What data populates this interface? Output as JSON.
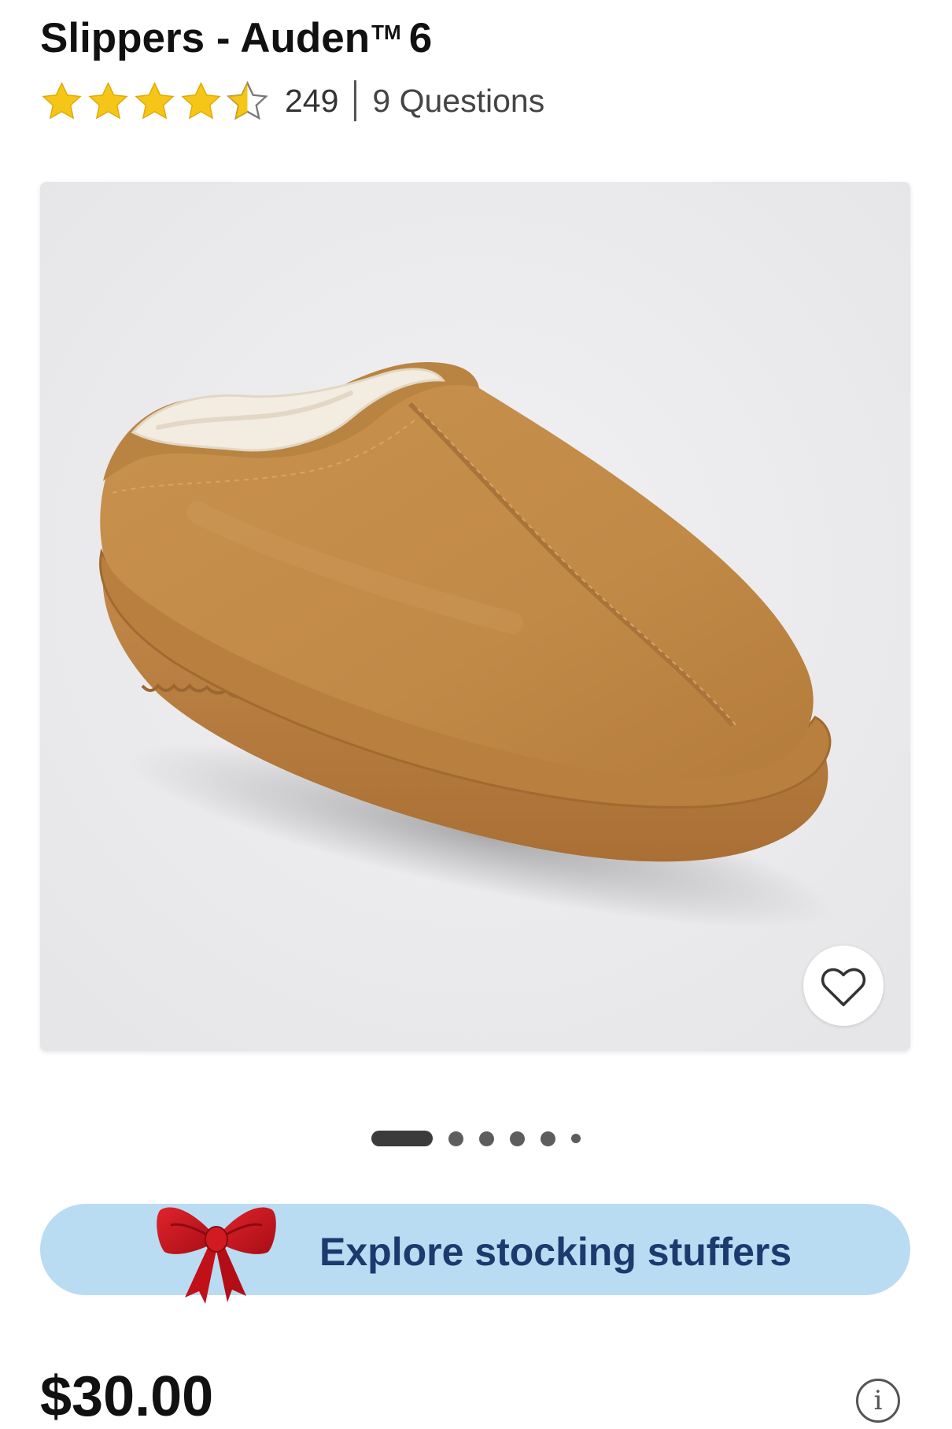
{
  "product": {
    "title_line2": "Slippers - Auden",
    "title_trademark": "TM",
    "title_line2_suffix": "6"
  },
  "rating": {
    "value": 4.5,
    "max": 5,
    "reviews_count": "249",
    "questions_label": "9 Questions"
  },
  "gallery": {
    "image_subject": "tan suede slip-on slipper with cream sherpa lining",
    "carousel_total": 6,
    "carousel_active_index": 0
  },
  "promo": {
    "label": "Explore stocking stuffers",
    "icon": "red-bow-icon"
  },
  "price": {
    "value": "$30.00"
  },
  "icons": {
    "favorite": "heart-outline-icon",
    "info": "info-icon"
  },
  "colors": {
    "star": "#f5c518",
    "promo_bg": "#b9dcf3",
    "promo_text": "#1d3a6e",
    "suede": "#c28b4a",
    "bow": "#d3161f"
  }
}
